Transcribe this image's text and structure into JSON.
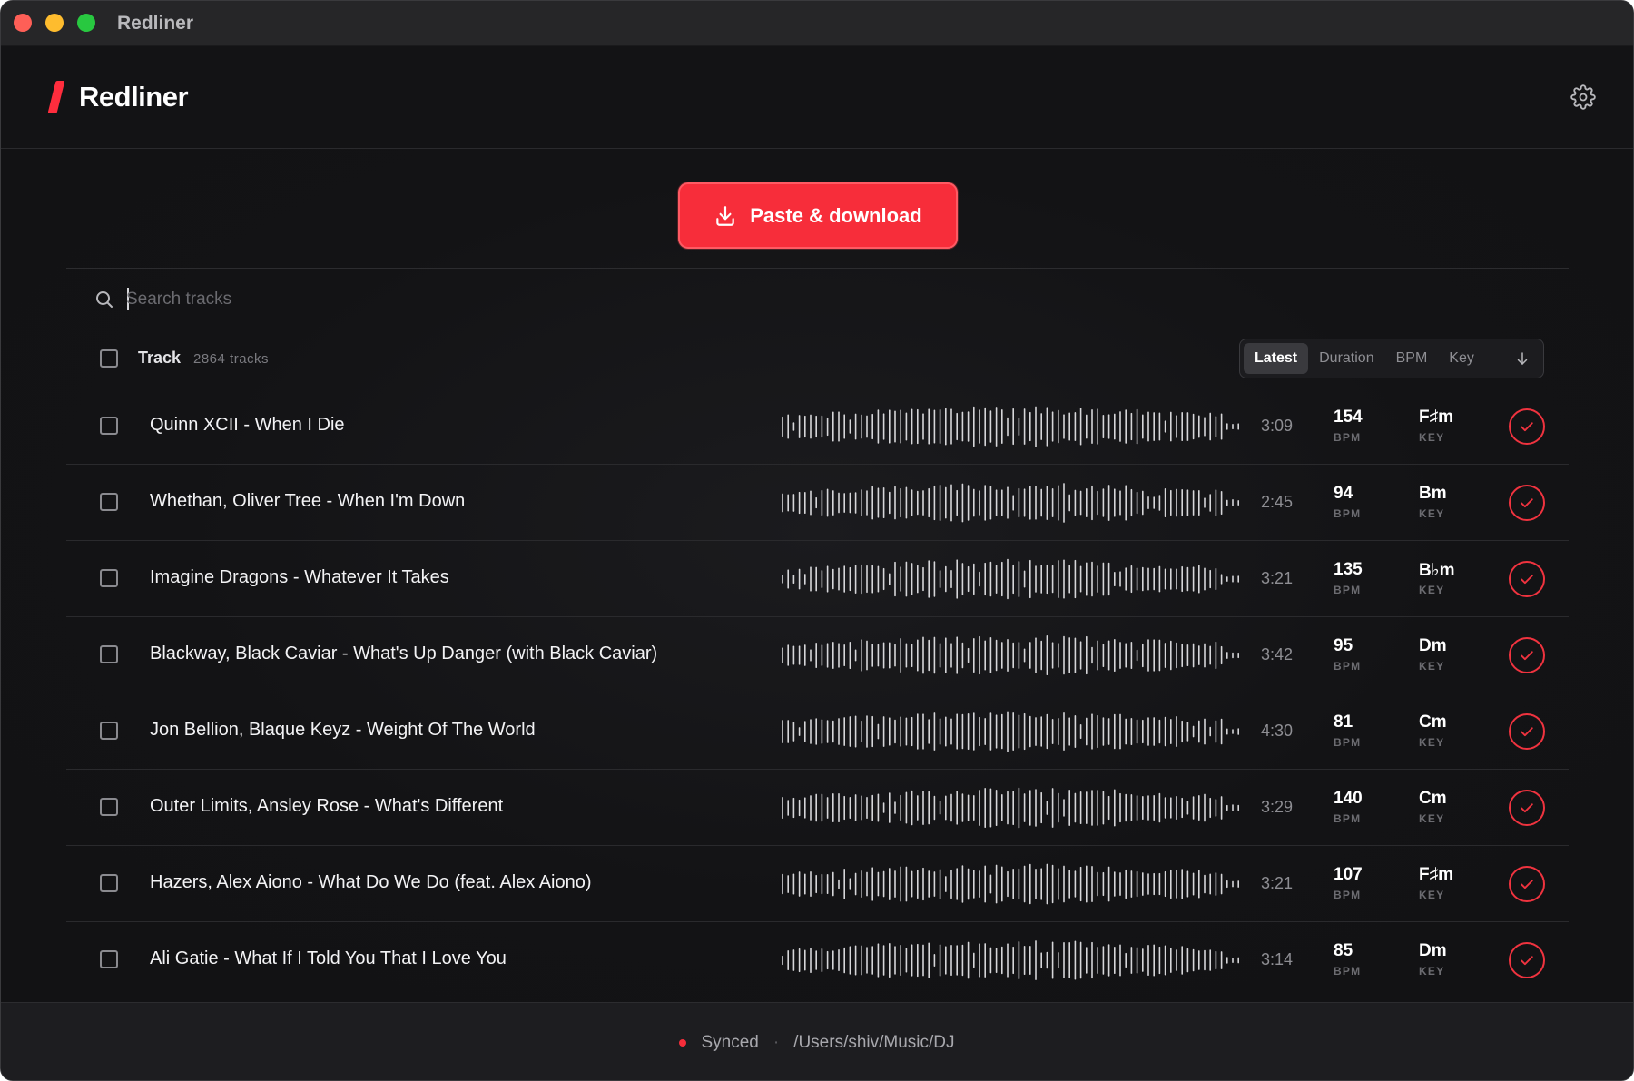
{
  "window": {
    "title": "Redliner"
  },
  "app": {
    "name": "Redliner"
  },
  "actions": {
    "paste_download_label": "Paste & download"
  },
  "search": {
    "placeholder": "Search tracks",
    "value": ""
  },
  "table": {
    "track_header": "Track",
    "track_count": "2864 tracks",
    "sort_options": [
      "Latest",
      "Duration",
      "BPM",
      "Key"
    ],
    "sort_active": "Latest",
    "bpm_unit": "BPM",
    "key_unit": "KEY"
  },
  "tracks": [
    {
      "title": "Quinn XCII - When I Die",
      "duration": "3:09",
      "bpm": "154",
      "key": "F♯m"
    },
    {
      "title": "Whethan, Oliver Tree - When I'm Down",
      "duration": "2:45",
      "bpm": "94",
      "key": "Bm"
    },
    {
      "title": "Imagine Dragons - Whatever It Takes",
      "duration": "3:21",
      "bpm": "135",
      "key": "B♭m"
    },
    {
      "title": "Blackway, Black Caviar - What's Up Danger (with Black Caviar)",
      "duration": "3:42",
      "bpm": "95",
      "key": "Dm"
    },
    {
      "title": "Jon Bellion, Blaque Keyz - Weight Of The World",
      "duration": "4:30",
      "bpm": "81",
      "key": "Cm"
    },
    {
      "title": "Outer Limits, Ansley Rose - What's Different",
      "duration": "3:29",
      "bpm": "140",
      "key": "Cm"
    },
    {
      "title": "Hazers, Alex Aiono - What Do We Do (feat. Alex Aiono)",
      "duration": "3:21",
      "bpm": "107",
      "key": "F♯m"
    },
    {
      "title": "Ali Gatie - What If I Told You That I Love You",
      "duration": "3:14",
      "bpm": "85",
      "key": "Dm"
    }
  ],
  "status": {
    "label": "Synced",
    "path": "/Users/shiv/Music/DJ"
  },
  "colors": {
    "accent": "#f72d3a",
    "background": "#121214",
    "text": "#f3f3f5",
    "muted": "#8e8e93"
  }
}
